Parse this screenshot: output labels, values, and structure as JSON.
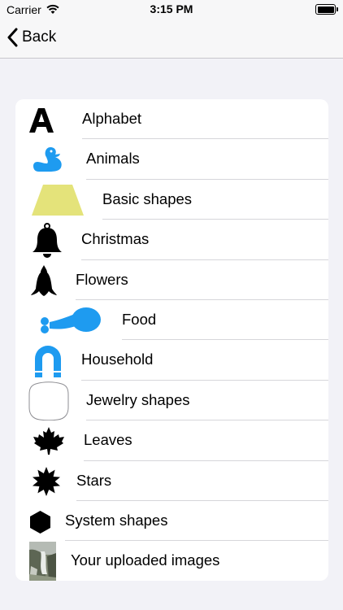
{
  "status_bar": {
    "carrier": "Carrier",
    "time": "3:15 PM"
  },
  "nav": {
    "back_label": "Back"
  },
  "categories": [
    {
      "label": "Alphabet",
      "icon": "letter-a-icon"
    },
    {
      "label": "Animals",
      "icon": "duck-icon",
      "color": "#1e9bf0"
    },
    {
      "label": "Basic shapes",
      "icon": "trapezoid-icon",
      "color": "#e4e37a"
    },
    {
      "label": "Christmas",
      "icon": "bell-icon"
    },
    {
      "label": "Flowers",
      "icon": "flower-icon"
    },
    {
      "label": "Food",
      "icon": "drumstick-icon",
      "color": "#1e9bf0"
    },
    {
      "label": "Household",
      "icon": "magnet-icon",
      "color": "#1e9bf0"
    },
    {
      "label": "Jewelry shapes",
      "icon": "rounded-square-icon"
    },
    {
      "label": "Leaves",
      "icon": "maple-leaf-icon"
    },
    {
      "label": "Stars",
      "icon": "star-burst-icon"
    },
    {
      "label": "System shapes",
      "icon": "hexagon-icon"
    },
    {
      "label": "Your uploaded images",
      "icon": "photo-thumbnail-icon"
    }
  ]
}
